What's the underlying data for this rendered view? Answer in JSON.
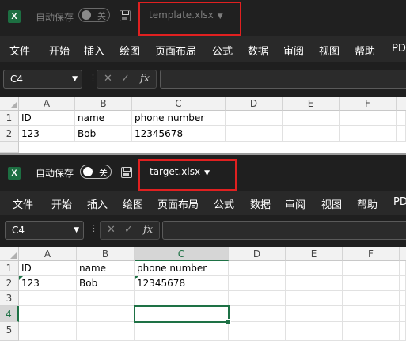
{
  "common": {
    "autosave_label": "自动保存",
    "toggle_state": "关",
    "menu": [
      "文件",
      "开始",
      "插入",
      "绘图",
      "页面布局",
      "公式",
      "数据",
      "审阅",
      "视图",
      "帮助",
      "PD"
    ],
    "namebox_value": "C4",
    "columns": [
      "A",
      "B",
      "C",
      "D",
      "E",
      "F"
    ],
    "fx_label": "fx"
  },
  "top_window": {
    "filename": "template.xlsx",
    "rows": [
      "1",
      "2"
    ],
    "cells": {
      "A1": "ID",
      "B1": "name",
      "C1": "phone number",
      "A2": "123",
      "B2": "Bob",
      "C2": "12345678"
    }
  },
  "bottom_window": {
    "filename": "target.xlsx",
    "rows": [
      "1",
      "2",
      "3",
      "4",
      "5"
    ],
    "cells": {
      "A1": "ID",
      "B1": "name",
      "C1": "phone number",
      "A2": "123",
      "B2": "Bob",
      "C2": "12345678"
    }
  },
  "colors": {
    "excel_green": "#1e7145",
    "titlebar": "#1f1f1f",
    "highlight_box": "#e02020"
  }
}
